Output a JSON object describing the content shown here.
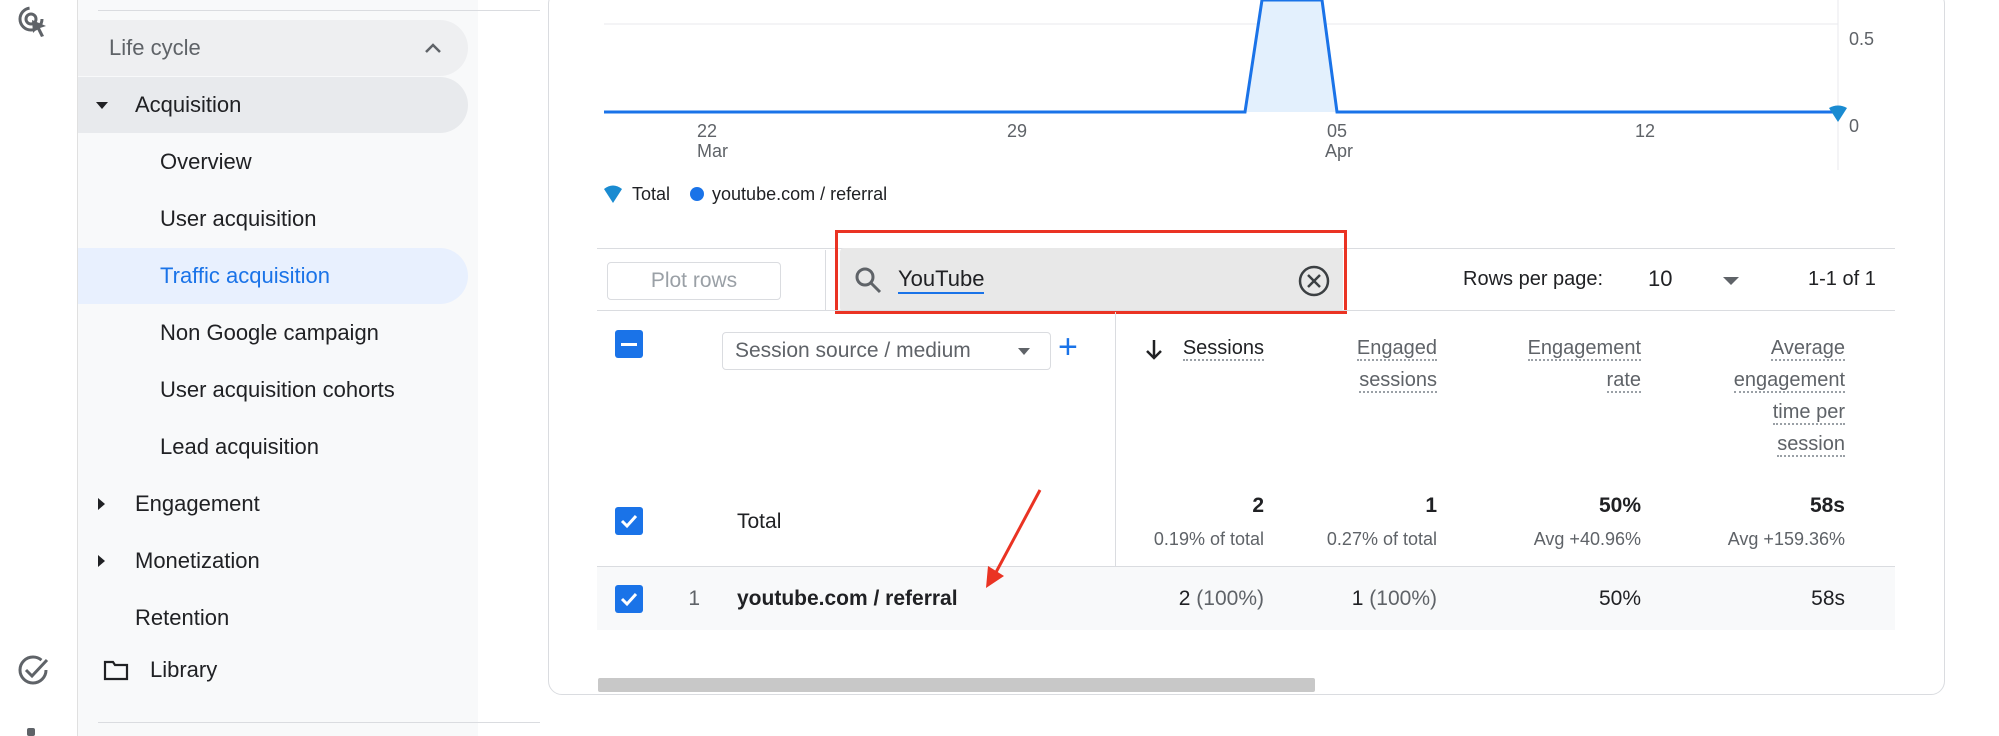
{
  "sidebar": {
    "section_label": "Life cycle",
    "acquisition_label": "Acquisition",
    "items": [
      "Overview",
      "User acquisition",
      "Traffic acquisition",
      "Non Google campaign",
      "User acquisition cohorts",
      "Lead acquisition"
    ],
    "engagement_label": "Engagement",
    "monetization_label": "Monetization",
    "retention_label": "Retention",
    "library_label": "Library"
  },
  "chart_data": {
    "type": "line",
    "x_ticks": [
      {
        "day": "22",
        "month": "Mar"
      },
      {
        "day": "29",
        "month": ""
      },
      {
        "day": "05",
        "month": "Apr"
      },
      {
        "day": "12",
        "month": ""
      }
    ],
    "y_ticks": [
      "0.5",
      "0"
    ],
    "series": [
      {
        "name": "Total",
        "color": "#1a73e8",
        "note": "single spike around Apr 3–4"
      },
      {
        "name": "youtube.com / referral",
        "color": "#1a73e8"
      }
    ]
  },
  "legend": {
    "total_label": "Total",
    "series_label": "youtube.com / referral"
  },
  "toolbar": {
    "plot_rows_label": "Plot rows",
    "search_value": "YouTube",
    "rows_per_page_label": "Rows per page:",
    "rows_per_page_value": "10",
    "pager_text": "1-1 of 1"
  },
  "table": {
    "dimension_label": "Session source / medium",
    "columns": {
      "sessions": "Sessions",
      "engaged_1": "Engaged",
      "engaged_2": "sessions",
      "rate_1": "Engagement",
      "rate_2": "rate",
      "avg_1": "Average",
      "avg_2": "engagement",
      "avg_3": "time per",
      "avg_4": "session"
    },
    "total": {
      "label": "Total",
      "sessions": "2",
      "sessions_sub": "0.19% of total",
      "engaged": "1",
      "engaged_sub": "0.27% of total",
      "rate": "50%",
      "rate_sub": "Avg +40.96%",
      "avg": "58s",
      "avg_sub": "Avg +159.36%"
    },
    "rows": [
      {
        "index": "1",
        "source": "youtube.com / referral",
        "sessions": "2",
        "sessions_pct": "(100%)",
        "engaged": "1",
        "engaged_pct": "(100%)",
        "rate": "50%",
        "avg": "58s"
      }
    ]
  },
  "colors": {
    "accent": "#1a73e8",
    "highlight": "#ea3323"
  }
}
